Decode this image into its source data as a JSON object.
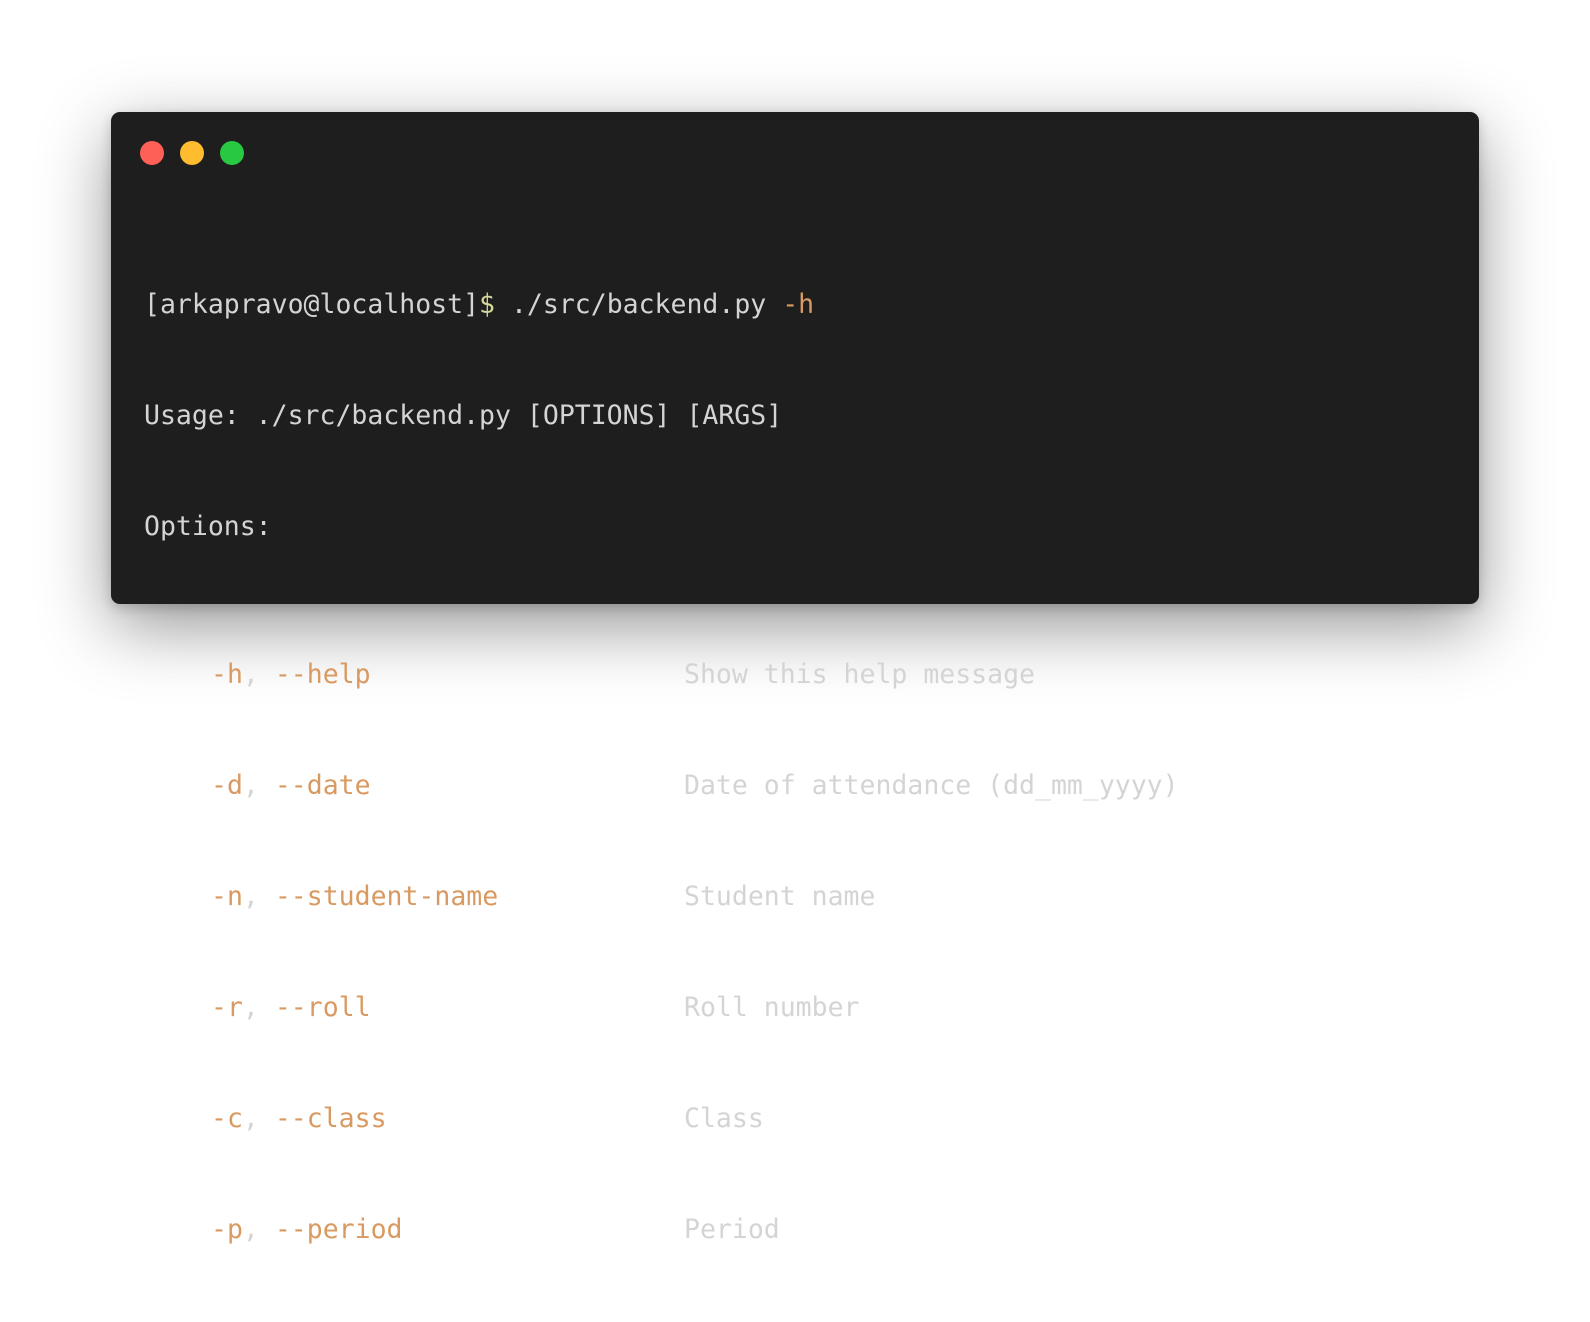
{
  "window": {
    "controls": {
      "close_color": "#fe5f57",
      "minimize_color": "#febc2e",
      "maximize_color": "#28c840"
    }
  },
  "terminal": {
    "prompt": {
      "user_host": "[arkapravo@localhost]",
      "symbol": "$",
      "command": " ./src/backend.py ",
      "flag": "-h"
    },
    "usage_line": "Usage: ./src/backend.py [OPTIONS] [ARGS]",
    "options_header": "Options:",
    "options": [
      {
        "short": "-h",
        "long": "--help",
        "description": "Show this help message"
      },
      {
        "short": "-d",
        "long": "--date",
        "description": "Date of attendance (dd_mm_yyyy)"
      },
      {
        "short": "-n",
        "long": "--student-name",
        "description": "Student name"
      },
      {
        "short": "-r",
        "long": "--roll",
        "description": "Roll number"
      },
      {
        "short": "-c",
        "long": "--class",
        "description": "Class"
      },
      {
        "short": "-p",
        "long": "--period",
        "description": "Period"
      }
    ],
    "separator": ", "
  },
  "colors": {
    "background": "#1e1e1e",
    "text": "#d4d4d4",
    "flag": "#d99a62",
    "prompt_symbol": "#d7d79a"
  }
}
